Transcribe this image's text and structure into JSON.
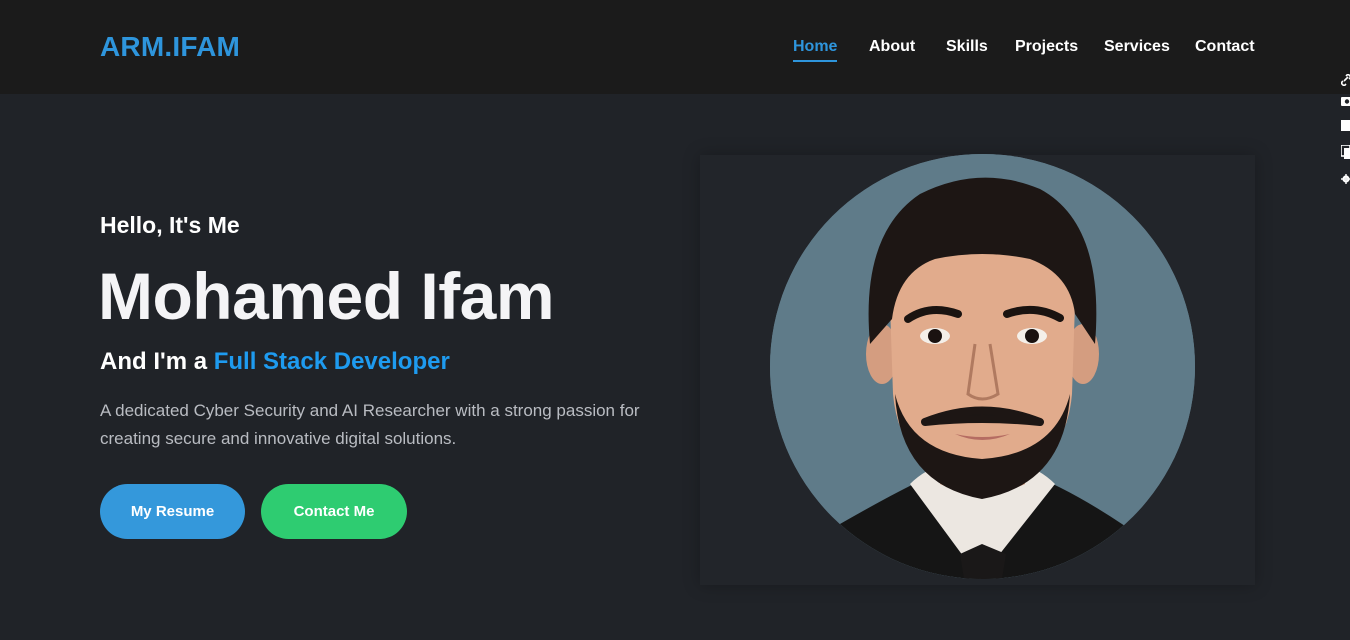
{
  "navbar": {
    "logo": "ARM.IFAM",
    "links": [
      "Home",
      "About",
      "Skills",
      "Projects",
      "Services",
      "Contact"
    ],
    "active": "Home"
  },
  "side_toolbar": {
    "icons": [
      "link-icon",
      "camera-icon",
      "square-icon",
      "copy-icon",
      "gear-icon"
    ]
  },
  "hero": {
    "greeting": "Hello, It's Me",
    "name": "Mohamed Ifam",
    "role_prefix": "And I'm a ",
    "role_highlight": "Full Stack Developer",
    "description": "A dedicated Cyber Security and AI Researcher with a strong passion for creating secure and innovative digital solutions.",
    "buttons": {
      "resume": "My Resume",
      "contact": "Contact Me"
    }
  },
  "colors": {
    "accent": "#2e95dc",
    "highlight": "#1e9bf0",
    "resume_button": "#3498db",
    "contact_button": "#2ecc71",
    "background": "#202328",
    "navbar": "#1b1b1b"
  }
}
